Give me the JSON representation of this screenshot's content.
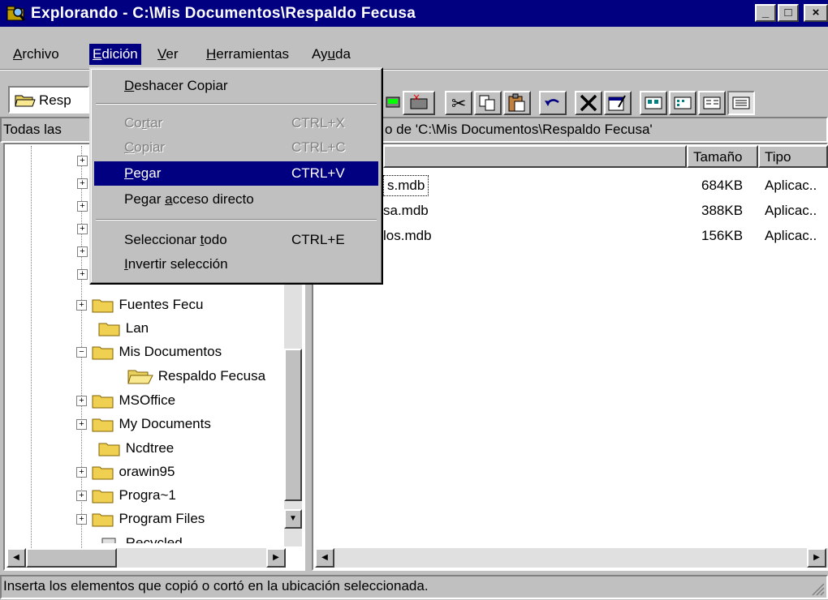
{
  "window": {
    "title": "Explorando - C:\\Mis Documentos\\Respaldo Fecusa",
    "minimize": "_",
    "maximize": "□",
    "close": "×"
  },
  "menubar": [
    {
      "pre": "",
      "key": "A",
      "post": "rchivo"
    },
    {
      "pre": "",
      "key": "E",
      "post": "dición"
    },
    {
      "pre": "",
      "key": "V",
      "post": "er"
    },
    {
      "pre": "",
      "key": "H",
      "post": "erramientas"
    },
    {
      "pre": "Ay",
      "key": "u",
      "post": "da"
    }
  ],
  "toolbar": {
    "location_value": "Resp"
  },
  "panes": {
    "left_header": "Todas las",
    "right_header_text": "o de 'C:\\Mis Documentos\\Respaldo Fecusa'"
  },
  "columns": {
    "size": "Tamaño",
    "type": "Tipo"
  },
  "edit_menu": [
    {
      "pre": "",
      "key": "D",
      "post": "eshacer Copiar",
      "accel": "",
      "disabled": false
    },
    {
      "pre": "Co",
      "key": "r",
      "post": "tar",
      "accel": "CTRL+X",
      "disabled": true
    },
    {
      "pre": "",
      "key": "C",
      "post": "opiar",
      "accel": "CTRL+C",
      "disabled": true
    },
    {
      "pre": "",
      "key": "P",
      "post": "egar",
      "accel": "CTRL+V",
      "disabled": false
    },
    {
      "pre": "Pegar ",
      "key": "a",
      "post": "cceso directo",
      "accel": "",
      "disabled": false
    },
    {
      "pre": "Seleccionar ",
      "key": "t",
      "post": "odo",
      "accel": "CTRL+E",
      "disabled": false
    },
    {
      "pre": "",
      "key": "I",
      "post": "nvertir selección",
      "accel": "",
      "disabled": false
    }
  ],
  "tree": [
    "Fuentes Fecu",
    "Lan",
    "Mis Documentos",
    "Respaldo Fecusa",
    "MSOffice",
    "My Documents",
    "Ncdtree",
    "orawin95",
    "Progra~1",
    "Program Files",
    "Recycled"
  ],
  "files": [
    {
      "name": "s.mdb",
      "size": "684KB",
      "type": "Aplicac.."
    },
    {
      "name": "sa.mdb",
      "size": "388KB",
      "type": "Aplicac.."
    },
    {
      "name": "los.mdb",
      "size": "156KB",
      "type": "Aplicac.."
    }
  ],
  "statusbar": {
    "text": "Inserta los elementos que copió o cortó en la ubicación seleccionada."
  }
}
